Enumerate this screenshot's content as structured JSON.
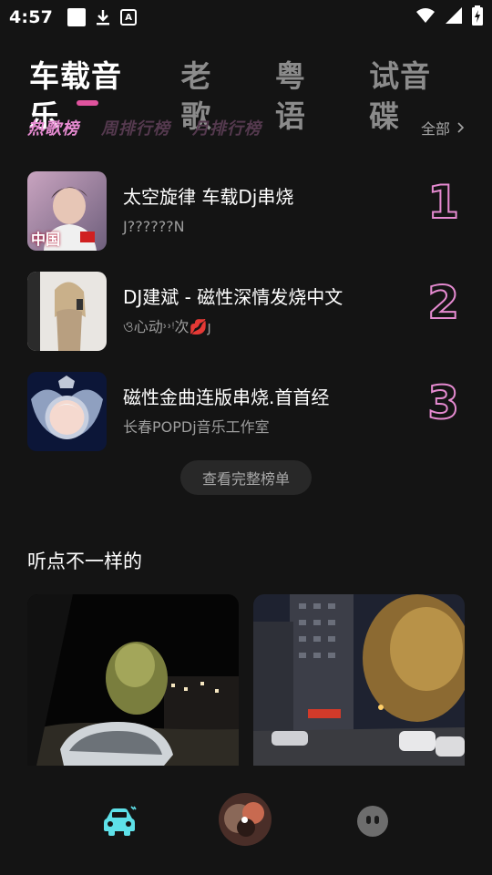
{
  "status_bar": {
    "time": "4:57"
  },
  "top_tabs": [
    {
      "label": "车载音乐",
      "active": true
    },
    {
      "label": "老歌",
      "active": false
    },
    {
      "label": "粤语",
      "active": false
    },
    {
      "label": "试音碟",
      "active": false
    }
  ],
  "sub_tabs": [
    {
      "label": "热歌榜",
      "active": true
    },
    {
      "label": "周排行榜",
      "active": false
    },
    {
      "label": "月排行榜",
      "active": false
    }
  ],
  "sub_all": "全部",
  "rank_list": [
    {
      "rank": "1",
      "title": "太空旋律 车载Dj串烧",
      "artist": "J??????N",
      "cover_text": "中国"
    },
    {
      "rank": "2",
      "title": "DJ建斌 - 磁性深情发烧中文",
      "artist": "ও心动˒˒ᵎ次💋ȷ"
    },
    {
      "rank": "3",
      "title": "磁性金曲连版串烧.首首经",
      "artist": "长春POPDj音乐工作室"
    }
  ],
  "view_all": "查看完整榜单",
  "section_title": "听点不一样的",
  "colors": {
    "accent_pink": "#e58ad0",
    "underline_pink": "#e0539e",
    "nav_active_cyan": "#5ee0e8",
    "background": "#141414"
  },
  "nav": {
    "items": [
      "car-icon",
      "now-playing-avatar",
      "face-icon"
    ]
  }
}
